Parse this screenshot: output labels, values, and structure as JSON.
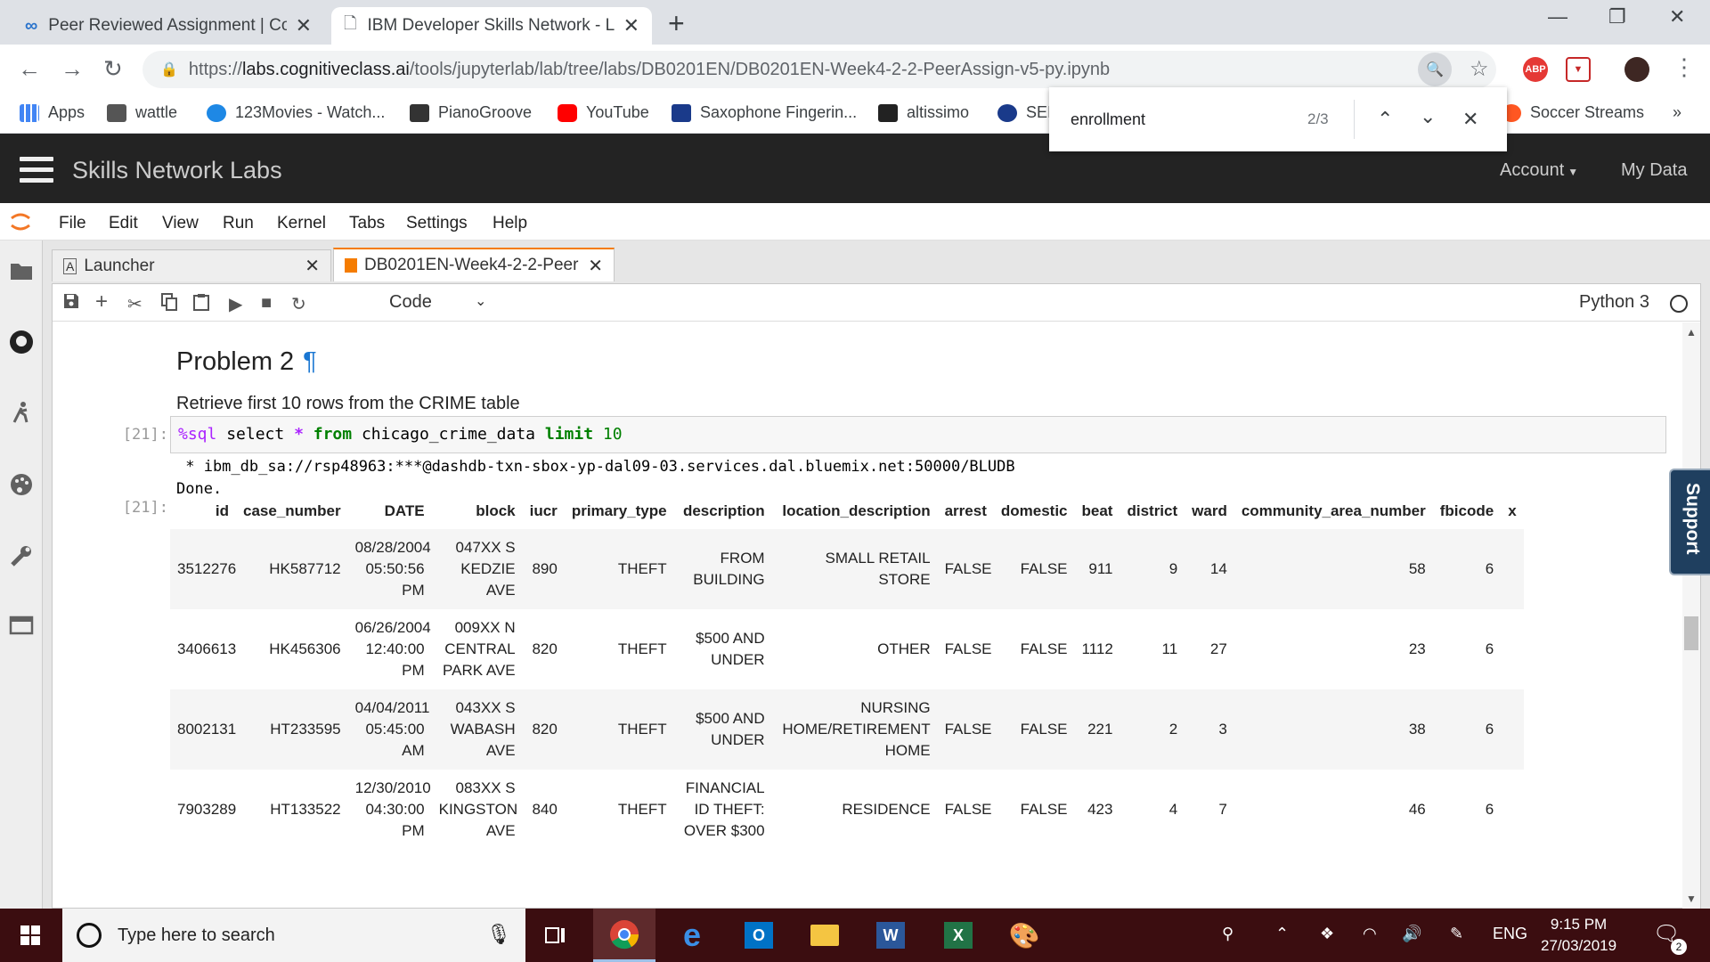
{
  "browser": {
    "tabs": [
      {
        "title": "Peer Reviewed Assignment | Cou",
        "active": false
      },
      {
        "title": "IBM Developer Skills Network - L",
        "active": true
      }
    ],
    "url_scheme": "https://",
    "url_host": "labs.cognitiveclass.ai",
    "url_path": "/tools/jupyterlab/lab/tree/labs/DB0201EN/DB0201EN-Week4-2-2-PeerAssign-v5-py.ipynb",
    "bookmarks": [
      {
        "label": "Apps",
        "color": "#4285f4"
      },
      {
        "label": "wattle",
        "color": "#555555"
      },
      {
        "label": "123Movies - Watch...",
        "color": "#1e88e5"
      },
      {
        "label": "PianoGroove",
        "color": "#333333"
      },
      {
        "label": "YouTube",
        "color": "#ff0000"
      },
      {
        "label": "Saxophone Fingerin...",
        "color": "#1a3a8a"
      },
      {
        "label": "altissimo",
        "color": "#222222"
      },
      {
        "label": "SEI",
        "color": "#1a3a8a"
      },
      {
        "label": "Soccer Streams",
        "color": "#ff5722"
      }
    ],
    "find": {
      "query": "enrollment",
      "count": "2/3"
    }
  },
  "header": {
    "brand": "Skills Network Labs",
    "account": "Account",
    "mydata": "My Data"
  },
  "menu": [
    "File",
    "Edit",
    "View",
    "Run",
    "Kernel",
    "Tabs",
    "Settings",
    "Help"
  ],
  "doctabs": [
    {
      "label": "Launcher"
    },
    {
      "label": "DB0201EN-Week4-2-2-Peer"
    }
  ],
  "notebook": {
    "cell_type": "Code",
    "kernel": "Python 3",
    "heading": "Problem 2",
    "pilcrow": "¶",
    "instruction": "Retrieve first 10 rows from the CRIME table",
    "prompt_in": "[21]:",
    "prompt_out": "[21]:",
    "code": {
      "magic": "%sql",
      "t1": " select ",
      "star": "*",
      "t2": " ",
      "from": "from",
      "t3": " chicago_crime_data ",
      "limit": "limit",
      "t4": " ",
      "n": "10"
    },
    "output_lines": [
      " * ibm_db_sa://rsp48963:***@dashdb-txn-sbox-yp-dal09-03.services.dal.bluemix.net:50000/BLUDB",
      "Done."
    ],
    "table": {
      "columns": [
        "id",
        "case_number",
        "DATE",
        "block",
        "iucr",
        "primary_type",
        "description",
        "location_description",
        "arrest",
        "domestic",
        "beat",
        "district",
        "ward",
        "community_area_number",
        "fbicode",
        "x"
      ],
      "rows": [
        [
          "3512276",
          "HK587712",
          "08/28/2004 05:50:56 PM",
          "047XX S KEDZIE AVE",
          "890",
          "THEFT",
          "FROM BUILDING",
          "SMALL RETAIL STORE",
          "FALSE",
          "FALSE",
          "911",
          "9",
          "14",
          "58",
          "6",
          ""
        ],
        [
          "3406613",
          "HK456306",
          "06/26/2004 12:40:00 PM",
          "009XX N CENTRAL PARK AVE",
          "820",
          "THEFT",
          "$500 AND UNDER",
          "OTHER",
          "FALSE",
          "FALSE",
          "1112",
          "11",
          "27",
          "23",
          "6",
          ""
        ],
        [
          "8002131",
          "HT233595",
          "04/04/2011 05:45:00 AM",
          "043XX S WABASH AVE",
          "820",
          "THEFT",
          "$500 AND UNDER",
          "NURSING HOME/RETIREMENT HOME",
          "FALSE",
          "FALSE",
          "221",
          "2",
          "3",
          "38",
          "6",
          ""
        ],
        [
          "7903289",
          "HT133522",
          "12/30/2010 04:30:00 PM",
          "083XX S KINGSTON AVE",
          "840",
          "THEFT",
          "FINANCIAL ID THEFT: OVER $300",
          "RESIDENCE",
          "FALSE",
          "FALSE",
          "423",
          "4",
          "7",
          "46",
          "6",
          ""
        ]
      ]
    }
  },
  "support_label": "Support",
  "taskbar": {
    "search_placeholder": "Type here to search",
    "time": "9:15 PM",
    "date": "27/03/2019",
    "lang": "ENG",
    "notifications": "2"
  }
}
